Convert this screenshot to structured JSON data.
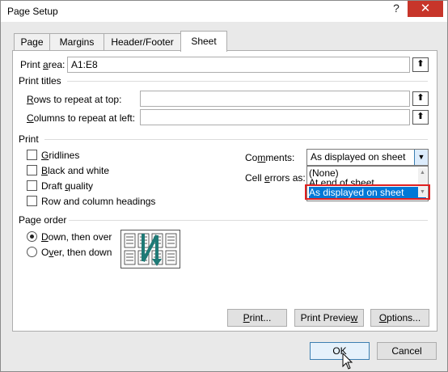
{
  "window": {
    "title": "Page Setup",
    "help": "?",
    "close": "✕"
  },
  "tabs": [
    {
      "label": "Page",
      "active": false
    },
    {
      "label": "Margins",
      "active": false
    },
    {
      "label": "Header/Footer",
      "active": false
    },
    {
      "label": "Sheet",
      "active": true
    }
  ],
  "print_area": {
    "label_prefix": "Print ",
    "label_u": "a",
    "label_suffix": "rea:",
    "value": "A1:E8"
  },
  "print_titles": {
    "heading": "Print titles",
    "rows_prefix": "",
    "rows_u": "R",
    "rows_suffix": "ows to repeat at top:",
    "cols_prefix": "",
    "cols_u": "C",
    "cols_suffix": "olumns to repeat at left:",
    "rows_value": "",
    "cols_value": ""
  },
  "print": {
    "heading": "Print",
    "gridlines_u": "G",
    "gridlines_rest": "ridlines",
    "bw_u": "B",
    "bw_rest": "lack and white",
    "draft_pre": "Draft ",
    "draft_u": "q",
    "draft_rest": "uality",
    "headings_label": "Row and column headings",
    "comments_pre": "Co",
    "comments_u": "m",
    "comments_rest": "ments:",
    "comments_value": "As displayed on sheet",
    "cell_errors_pre": "Cell ",
    "cell_errors_u": "e",
    "cell_errors_rest": "rrors as:",
    "dropdown_options": [
      "(None)",
      "At end of sheet",
      "As displayed on sheet"
    ],
    "dropdown_selected": "As displayed on sheet"
  },
  "page_order": {
    "heading": "Page order",
    "down_u": "D",
    "down_rest": "own, then over",
    "over_pre": "O",
    "over_u": "v",
    "over_rest": "er, then down",
    "selected": "Down, then over"
  },
  "buttons": {
    "print_u": "P",
    "print_rest": "rint...",
    "preview_pre": "Print Previe",
    "preview_u": "w",
    "preview_rest": "",
    "options_u": "O",
    "options_rest": "ptions...",
    "ok": "OK",
    "cancel": "Cancel"
  },
  "colors": {
    "close": "#c7352a",
    "selected": "#0078d7",
    "highlight": "#e02020",
    "arrow_teal": "#1f7a76"
  }
}
